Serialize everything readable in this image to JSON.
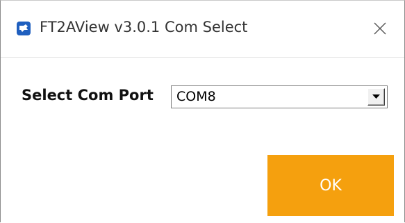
{
  "window": {
    "title": "FT2AView v3.0.1 Com Select",
    "icon": "app-logo-icon",
    "close_icon": "close-icon"
  },
  "form": {
    "com_port_label": "Select Com Port",
    "com_port_value": "COM8",
    "dropdown_icon": "dropdown-arrow-icon"
  },
  "actions": {
    "ok_label": "OK"
  },
  "colors": {
    "accent": "#f5a00e",
    "app_icon": "#1f5fbf"
  }
}
